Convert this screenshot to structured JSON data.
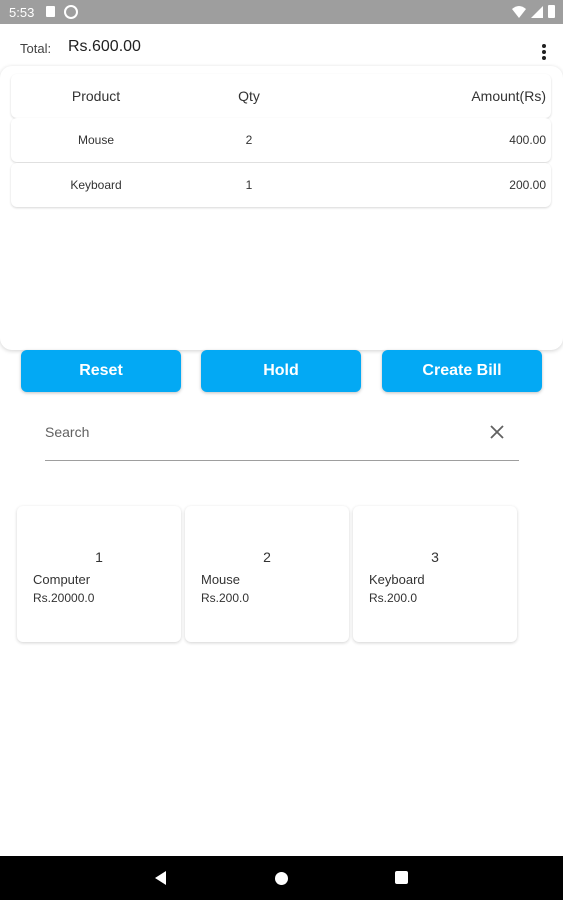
{
  "status_bar": {
    "time": "5:53",
    "icons": [
      "sd-card-icon",
      "at-circle-icon",
      "wifi-icon",
      "signal-icon",
      "battery-icon"
    ]
  },
  "header": {
    "total_label": "Total:",
    "total_value": "Rs.600.00",
    "menu_icon": "more-vert-icon"
  },
  "cart_table": {
    "columns": [
      "Product",
      "Qty",
      "Amount(Rs)"
    ],
    "rows": [
      {
        "product": "Mouse",
        "qty": "2",
        "amount": "400.00"
      },
      {
        "product": "Keyboard",
        "qty": "1",
        "amount": "200.00"
      }
    ]
  },
  "actions": {
    "reset_label": "Reset",
    "hold_label": "Hold",
    "create_bill_label": "Create Bill"
  },
  "search": {
    "placeholder": "Search",
    "value": "",
    "clear_icon": "close-icon"
  },
  "products": [
    {
      "id": "1",
      "name": "Computer",
      "price": "Rs.20000.0"
    },
    {
      "id": "2",
      "name": "Mouse",
      "price": "Rs.200.0"
    },
    {
      "id": "3",
      "name": "Keyboard",
      "price": "Rs.200.0"
    }
  ],
  "colors": {
    "accent": "#03a9f4",
    "status_bar": "#9e9e9e",
    "nav_bar": "#000000"
  },
  "nav_bar": {
    "icons": [
      "back-icon",
      "home-icon",
      "recents-icon"
    ]
  }
}
